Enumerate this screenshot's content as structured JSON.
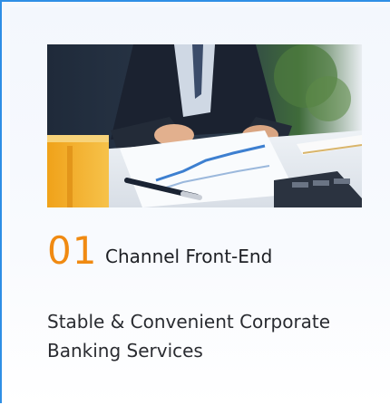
{
  "card": {
    "number": "01",
    "title": "Channel Front-End",
    "description": "Stable & Convenient Corporate Banking Services",
    "image_alt": "businessman reviewing financial charts with pen and calculator"
  },
  "colors": {
    "accent_border": "#2f8fe5",
    "number_orange": "#f08a12",
    "text_dark": "#1d1f24"
  }
}
